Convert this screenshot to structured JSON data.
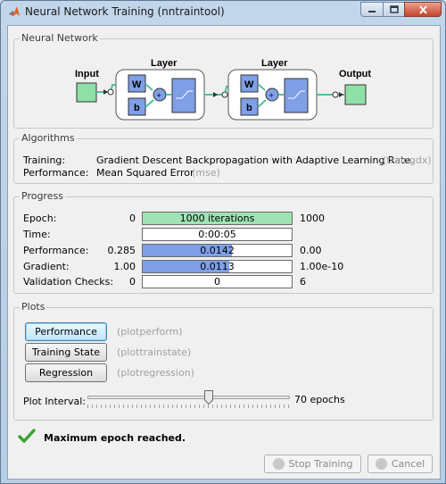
{
  "window": {
    "title": "Neural Network Training (nntraintool)"
  },
  "network": {
    "section_title": "Neural Network",
    "input_label": "Input",
    "output_label": "Output",
    "layer1": {
      "label": "Layer",
      "weight": "W",
      "bias": "b",
      "sum": "+"
    },
    "layer2": {
      "label": "Layer",
      "weight": "W",
      "bias": "b",
      "sum": "+"
    }
  },
  "algorithms": {
    "section_title": "Algorithms",
    "training_label": "Training:",
    "training_value": "Gradient Descent Backpropagation with Adaptive Learning Rate.",
    "training_code": "(traingdx)",
    "performance_label": "Performance:",
    "performance_value": "Mean Squared Error",
    "performance_code": "(mse)"
  },
  "progress": {
    "section_title": "Progress",
    "rows": [
      {
        "label": "Epoch:",
        "start": "0",
        "value": "1000 iterations",
        "end": "1000",
        "fill": 1.0,
        "color": "#9fe3b4"
      },
      {
        "label": "Time:",
        "start": "",
        "value": "0:00:05",
        "end": "",
        "fill": 0,
        "color": "#ffffff"
      },
      {
        "label": "Performance:",
        "start": "0.285",
        "value": "0.0142",
        "end": "0.00",
        "fill": 0.6,
        "color": "#7f9fe6"
      },
      {
        "label": "Gradient:",
        "start": "1.00",
        "value": "0.0113",
        "end": "1.00e-10",
        "fill": 0.58,
        "color": "#7f9fe6"
      },
      {
        "label": "Validation Checks:",
        "start": "0",
        "value": "0",
        "end": "6",
        "fill": 0,
        "color": "#ffffff"
      }
    ]
  },
  "plots": {
    "section_title": "Plots",
    "buttons": [
      {
        "label": "Performance",
        "code": "(plotperform)"
      },
      {
        "label": "Training State",
        "code": "(plottrainstate)"
      },
      {
        "label": "Regression",
        "code": "(plotregression)"
      }
    ],
    "interval_label": "Plot Interval:",
    "interval_value": "70 epochs",
    "interval_fraction": 0.6
  },
  "status": {
    "message": "Maximum epoch reached.",
    "icon": "check-icon"
  },
  "footer": {
    "stop_label": "Stop Training",
    "cancel_label": "Cancel"
  },
  "colors": {
    "box_green": "#8ee0a6",
    "box_blue": "#7f9fe6",
    "connector": "#4fbf9f"
  }
}
